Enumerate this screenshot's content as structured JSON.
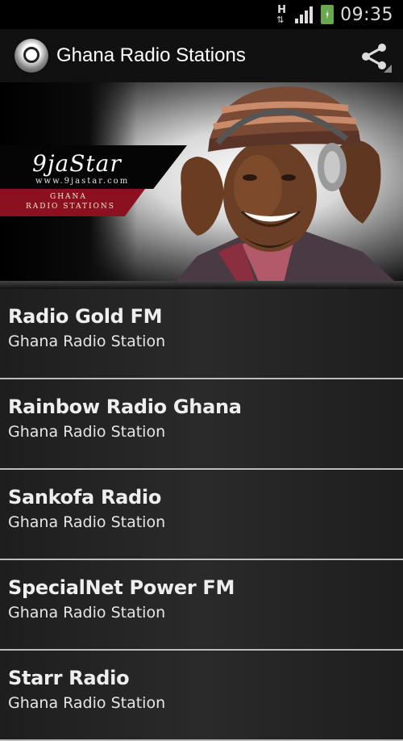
{
  "status_bar": {
    "network_letter": "H",
    "time": "09:35",
    "icons": [
      "hspa-data-icon",
      "signal-strength-icon",
      "battery-charging-icon"
    ]
  },
  "action_bar": {
    "title": "Ghana Radio Stations",
    "icons": [
      "app-logo-icon",
      "share-icon"
    ]
  },
  "banner": {
    "logo_text": "9jaStar",
    "logo_url": "www.9jastar.com",
    "ribbon_line1": "GHANA",
    "ribbon_line2": "RADIO STATIONS",
    "colors": {
      "ribbon": "#8b1020",
      "band": "#050505"
    }
  },
  "stations": [
    {
      "name": "Radio Gold FM",
      "subtitle": "Ghana Radio Station"
    },
    {
      "name": "Rainbow Radio Ghana",
      "subtitle": "Ghana Radio Station"
    },
    {
      "name": "Sankofa Radio",
      "subtitle": "Ghana Radio Station"
    },
    {
      "name": "SpecialNet Power FM",
      "subtitle": "Ghana Radio Station"
    },
    {
      "name": "Starr Radio",
      "subtitle": "Ghana Radio Station"
    }
  ]
}
